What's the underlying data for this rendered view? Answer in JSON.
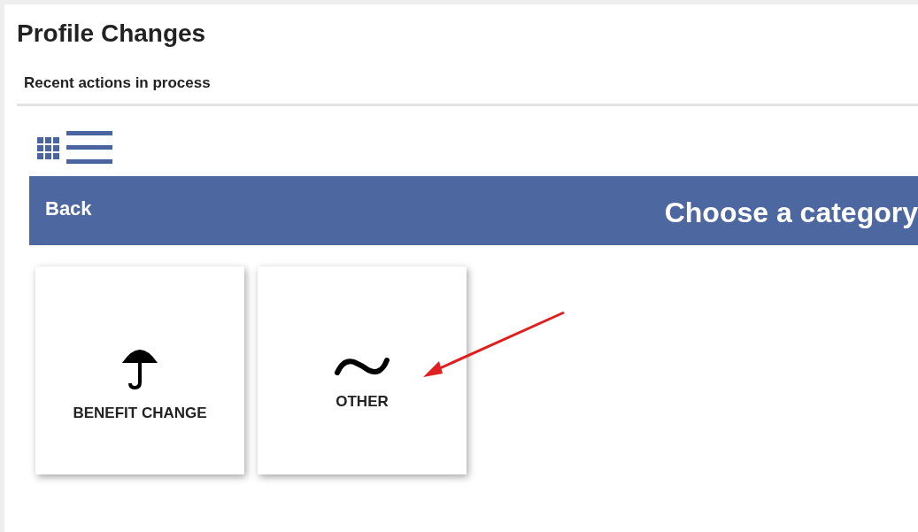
{
  "title": "Profile Changes",
  "section": "Recent actions in process",
  "view_toggle": [
    {
      "kind": "grid"
    },
    {
      "kind": "list"
    }
  ],
  "header_bar": {
    "back": "Back",
    "heading": "Choose a category"
  },
  "categories": [
    {
      "label": "BENEFIT CHANGE",
      "kind": "umbrella"
    },
    {
      "label": "OTHER",
      "kind": "tilde"
    }
  ]
}
